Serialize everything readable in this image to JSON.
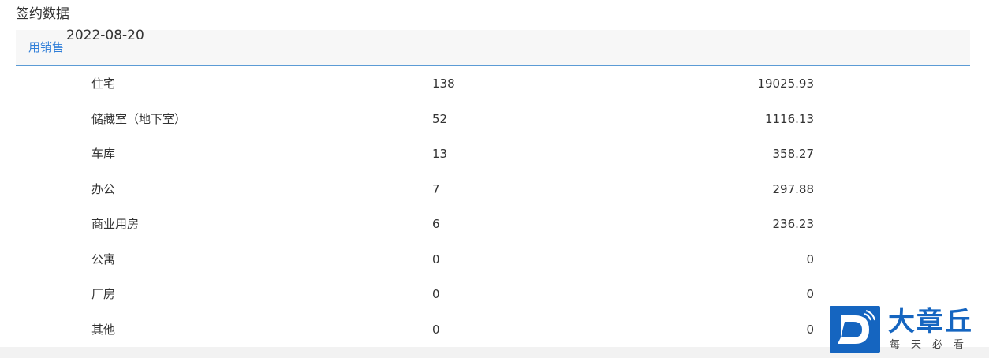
{
  "section_title": "签约数据",
  "tab_label": "用销售",
  "date": "2022-08-20",
  "rows": [
    {
      "name": "住宅",
      "count": "138",
      "area": "19025.93"
    },
    {
      "name": "储藏室（地下室）",
      "count": "52",
      "area": "1116.13"
    },
    {
      "name": "车库",
      "count": "13",
      "area": "358.27"
    },
    {
      "name": "办公",
      "count": "7",
      "area": "297.88"
    },
    {
      "name": "商业用房",
      "count": "6",
      "area": "236.23"
    },
    {
      "name": "公寓",
      "count": "0",
      "area": "0"
    },
    {
      "name": "厂房",
      "count": "0",
      "area": "0"
    },
    {
      "name": "其他",
      "count": "0",
      "area": "0"
    }
  ],
  "watermark": {
    "brand": "大章丘",
    "tagline": "每天必看",
    "colors": {
      "accent": "#1565c0"
    }
  }
}
